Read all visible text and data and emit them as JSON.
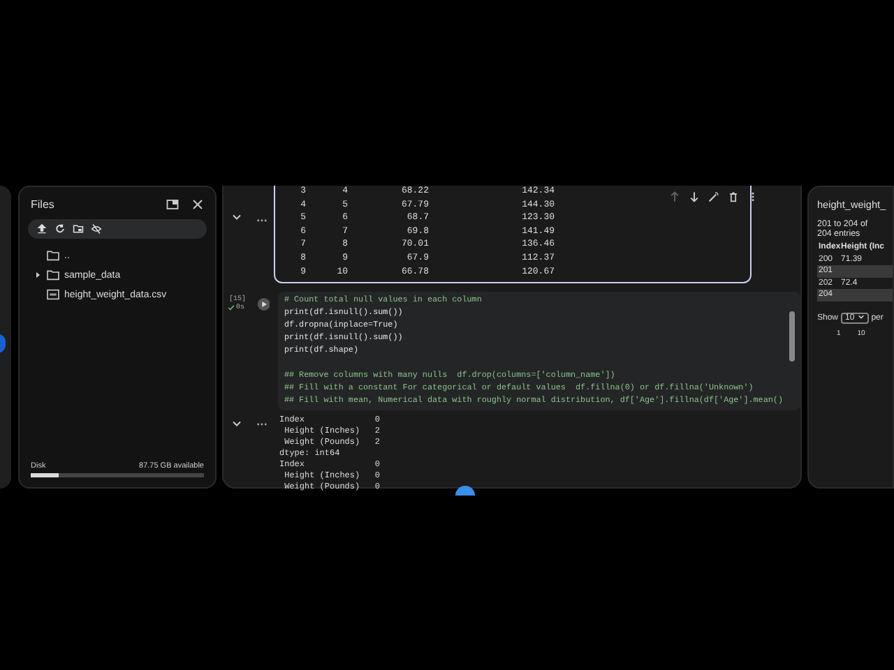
{
  "files_panel": {
    "title": "Files",
    "tree": [
      {
        "label": "..",
        "kind": "folder",
        "expandable": false
      },
      {
        "label": "sample_data",
        "kind": "folder",
        "expandable": true
      },
      {
        "label": "height_weight_data.csv",
        "kind": "csv",
        "expandable": false
      }
    ],
    "disk": {
      "label": "Disk",
      "available": "87.75 GB available",
      "level": 0.16
    }
  },
  "notebook": {
    "table_output": {
      "rows": [
        [
          "3",
          "4",
          "68.22",
          "142.34"
        ],
        [
          "4",
          "5",
          "67.79",
          "144.30"
        ],
        [
          "5",
          "6",
          "68.7",
          "123.30"
        ],
        [
          "6",
          "7",
          "69.8",
          "141.49"
        ],
        [
          "7",
          "8",
          "70.01",
          "136.46"
        ],
        [
          "8",
          "9",
          "67.9",
          "112.37"
        ],
        [
          "9",
          "10",
          "66.78",
          "120.67"
        ]
      ]
    },
    "code_cell": {
      "execution_count": "[15]",
      "status": "0s",
      "lines": [
        {
          "kind": "comment",
          "text": "# Count total null values in each column"
        },
        {
          "kind": "code",
          "text": "print(df.isnull().sum())"
        },
        {
          "kind": "code",
          "text": "df.dropna(inplace=True)"
        },
        {
          "kind": "code",
          "text": "print(df.isnull().sum())"
        },
        {
          "kind": "code",
          "text": "print(df.shape)"
        },
        {
          "kind": "blank"
        },
        {
          "kind": "comment",
          "text": "## Remove columns with many nulls  df.drop(columns=['column_name'])"
        },
        {
          "kind": "comment",
          "text": "## Fill with a constant For categorical or default values  df.fillna(0) or df.fillna('Unknown')"
        },
        {
          "kind": "comment",
          "text": "## Fill with mean, Numerical data with roughly normal distribution, df['Age'].fillna(df['Age'].mean()"
        }
      ]
    },
    "output_lines": [
      "Index              0",
      " Height (Inches)   2",
      " Weight (Pounds)   2",
      "dtype: int64",
      "Index              0",
      " Height (Inches)   0",
      " Weight (Pounds)   0"
    ]
  },
  "data_panel": {
    "title": "height_weight_",
    "entries": "201 to 204 of 204 entries",
    "columns": [
      "Index",
      "Height (Inc"
    ],
    "rows": [
      [
        "200",
        "71.39"
      ],
      [
        "201",
        ""
      ],
      [
        "202",
        "72.4"
      ],
      [
        "204",
        ""
      ]
    ],
    "show_label": "Show",
    "page_size": "10",
    "per_label": "per",
    "pages": [
      "1",
      "10"
    ]
  }
}
